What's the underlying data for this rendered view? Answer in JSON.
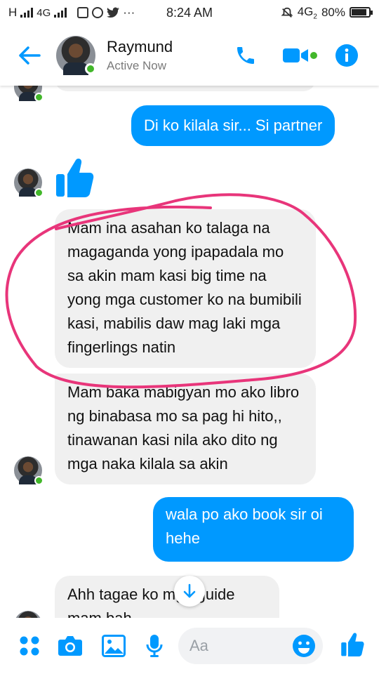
{
  "status_bar": {
    "network_left": "H",
    "network_mid": "4G",
    "time": "8:24 AM",
    "network_right": "4G",
    "network_right_sub": "2",
    "battery": "80%",
    "battery_level": 0.8,
    "more": "···"
  },
  "header": {
    "name": "Raymund",
    "status": "Active Now"
  },
  "messages": {
    "m1": "Di ko kilala sir... Si partner",
    "m2": "Mam ina asahan ko talaga na magaganda yong ipapadala mo sa akin mam kasi big time na yong mga customer ko na bumibili kasi, mabilis daw mag laki mga fingerlings natin",
    "m3": "Mam baka mabigyan mo ako libro ng binabasa mo sa pag hi hito,, tinawanan kasi nila ako dito ng mga naka kilala sa akin",
    "m4": "wala po ako book sir oi hehe",
    "m5": "Ahh tagae ko mga guide mam bah"
  },
  "composer": {
    "placeholder": "Aa"
  },
  "colors": {
    "accent": "#0099ff",
    "online": "#42b72a",
    "incoming_bubble": "#f0f0f0",
    "annotation": "#e8357a"
  }
}
